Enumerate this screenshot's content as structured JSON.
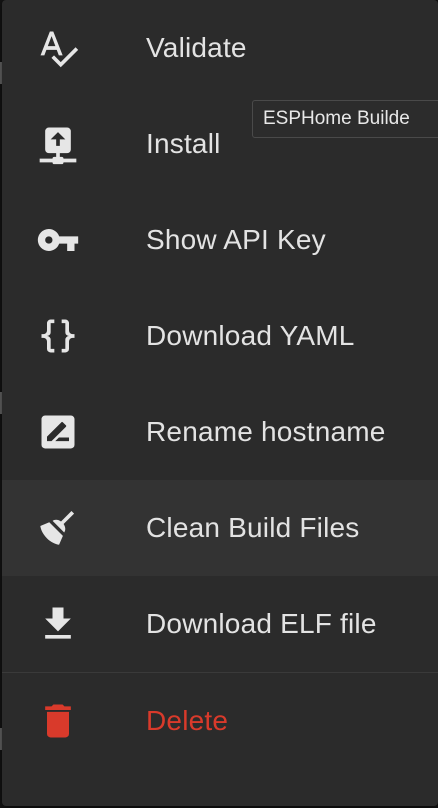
{
  "menu": {
    "items": [
      {
        "label": "Validate",
        "icon": "spellcheck-icon"
      },
      {
        "label": "Install",
        "icon": "upload-network-icon"
      },
      {
        "label": "Show API Key",
        "icon": "key-icon"
      },
      {
        "label": "Download YAML",
        "icon": "code-braces-icon"
      },
      {
        "label": "Rename hostname",
        "icon": "rename-box-icon"
      },
      {
        "label": "Clean Build Files",
        "icon": "broom-icon"
      },
      {
        "label": "Download ELF file",
        "icon": "download-icon"
      },
      {
        "label": "Delete",
        "icon": "delete-icon"
      }
    ],
    "hovered_item": "Clean Build Files"
  },
  "tooltip": {
    "text": "ESPHome Builde"
  },
  "colors": {
    "menu_background": "#2b2b2b",
    "text": "#e3e3e3",
    "icon": "#e6e6e6",
    "danger": "#d93a2b"
  }
}
